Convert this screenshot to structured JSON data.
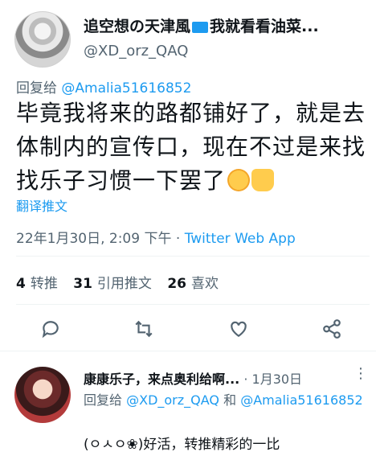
{
  "tweet": {
    "author_name": "追空想の天津風",
    "author_name_suffix": "我就看看油菜...",
    "author_handle": "@XD_orz_QAQ",
    "reply_prefix": "回复给",
    "reply_handle": "@Amalia51616852",
    "text_line1": "毕竟我将来的路都铺好了，就是去",
    "text_line2": "体制内的宣传口，现在不过是来找",
    "text_line3": "找乐子习惯一下罢了",
    "emoji_1": "yum-face-emoji",
    "emoji_2": "thumbs-up-emoji",
    "translate_label": "翻译推文",
    "date": "22年1月30日, 2:09 下午 · ",
    "source": "Twitter Web App",
    "retweets_count": "4",
    "retweets_label": "转推",
    "quotes_count": "31",
    "quotes_label": "引用推文",
    "likes_count": "26",
    "likes_label": "喜欢"
  },
  "actions": [
    "reply-icon",
    "retweet-icon",
    "like-icon",
    "share-icon"
  ],
  "reply": {
    "name": "康康乐子，来点奥利给啊...",
    "date": " · 1月30日",
    "more": "⋮",
    "reply_prefix": "回复给",
    "reply_handle_1": "@XD_orz_QAQ",
    "reply_and": "和",
    "reply_handle_2": "@Amalia51616852",
    "text": "(ㅇㅅㅇ❀)好活，转推精彩的一比"
  },
  "colors": {
    "accent": "#1d9bf0",
    "secondary": "#536471",
    "text": "#0f1419"
  }
}
